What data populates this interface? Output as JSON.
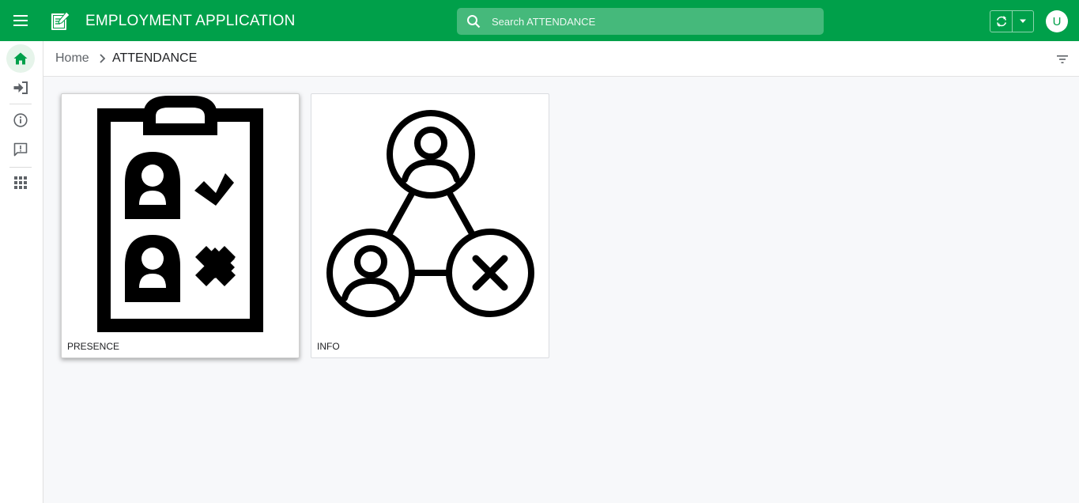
{
  "header": {
    "title": "EMPLOYMENT APPLICATION",
    "menu_icon": "hamburger-menu-icon",
    "app_icon": "notepad-app-icon",
    "bg_color": "#00a04a"
  },
  "search": {
    "placeholder": "Search ATTENDANCE"
  },
  "user": {
    "initial": "U"
  },
  "sidebar": {
    "items": [
      {
        "icon": "home-icon",
        "active": true
      },
      {
        "icon": "sign-in-icon"
      },
      {
        "icon": "info-icon"
      },
      {
        "icon": "feedback-icon"
      },
      {
        "icon": "apps-grid-icon"
      }
    ]
  },
  "breadcrumb": {
    "home": "Home",
    "current": "ATTENDANCE"
  },
  "tiles": [
    {
      "label": "PRESENCE",
      "icon": "clipboard-attendance-icon"
    },
    {
      "label": "INFO",
      "icon": "network-users-icon"
    }
  ]
}
